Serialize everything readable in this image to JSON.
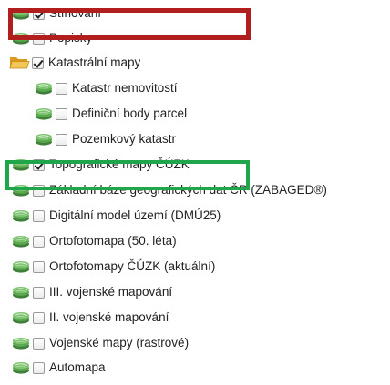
{
  "colors": {
    "highlight_red": "#b01e1e",
    "highlight_green": "#1fa64a",
    "layer_icon": "#4e9a46",
    "folder_icon": "#e9b74a"
  },
  "layers": [
    {
      "label": "Stínování",
      "checked": true,
      "icon": "layer-icon",
      "level": 0
    },
    {
      "label": "Popisky",
      "checked": false,
      "icon": "layer-icon",
      "level": 0
    },
    {
      "label": "Katastrální mapy",
      "checked": true,
      "icon": "folder-open-icon",
      "level": 0
    },
    {
      "label": "Katastr nemovitostí",
      "checked": false,
      "icon": "layer-icon",
      "level": 1
    },
    {
      "label": "Definiční body parcel",
      "checked": false,
      "icon": "layer-icon",
      "level": 1
    },
    {
      "label": "Pozemkový katastr",
      "checked": false,
      "icon": "layer-icon",
      "level": 1
    },
    {
      "label": "Topografické mapy ČÚZK",
      "checked": true,
      "icon": "layer-icon",
      "level": 0
    },
    {
      "label": "Základní báze geografických dat ČR (ZABAGED®)",
      "checked": false,
      "icon": "layer-icon",
      "level": 0
    },
    {
      "label": "Digitální model území (DMÚ25)",
      "checked": false,
      "icon": "layer-icon",
      "level": 0
    },
    {
      "label": "Ortofotomapa (50. léta)",
      "checked": false,
      "icon": "layer-icon",
      "level": 0
    },
    {
      "label": "Ortofotomapy ČÚZK (aktuální)",
      "checked": false,
      "icon": "layer-icon",
      "level": 0
    },
    {
      "label": "III. vojenské mapování",
      "checked": false,
      "icon": "layer-icon",
      "level": 0
    },
    {
      "label": "II. vojenské mapování",
      "checked": false,
      "icon": "layer-icon",
      "level": 0
    },
    {
      "label": "Vojenské mapy (rastrové)",
      "checked": false,
      "icon": "layer-icon",
      "level": 0
    },
    {
      "label": "Automapa",
      "checked": false,
      "icon": "layer-icon",
      "level": 0
    }
  ]
}
